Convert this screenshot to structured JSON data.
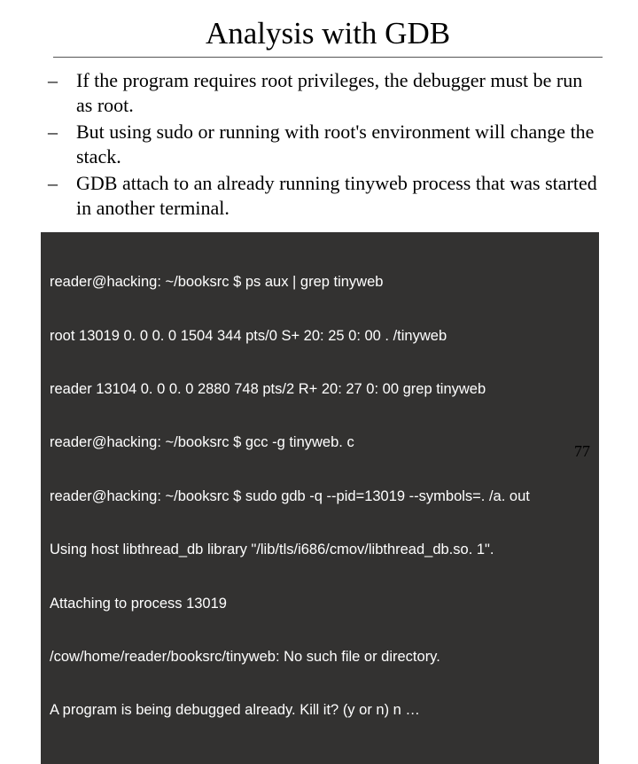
{
  "title": "Analysis with GDB",
  "bullets": [
    "If the program requires root privileges, the debugger must be run as root.",
    "But using sudo or running with root's environment will change the stack.",
    "GDB attach to an already running tinyweb process that was started in  another terminal."
  ],
  "terminal_lines": [
    "reader@hacking: ~/booksrc $ ps aux | grep tinyweb",
    "root     13019  0. 0  0. 0   1504   344 pts/0    S+   20: 25   0: 00 . /tinyweb",
    "reader   13104  0. 0  0. 0   2880   748 pts/2    R+   20: 27   0: 00 grep tinyweb",
    "reader@hacking: ~/booksrc $ gcc -g tinyweb. c",
    "reader@hacking: ~/booksrc $ sudo gdb -q --pid=13019 --symbols=. /a. out",
    "Using host libthread_db library \"/lib/tls/i686/cmov/libthread_db.so. 1\".",
    "Attaching to process 13019",
    "/cow/home/reader/booksrc/tinyweb: No such file or directory.",
    "A program is being debugged already.  Kill it? (y or n) n …"
  ],
  "page_number": "77"
}
